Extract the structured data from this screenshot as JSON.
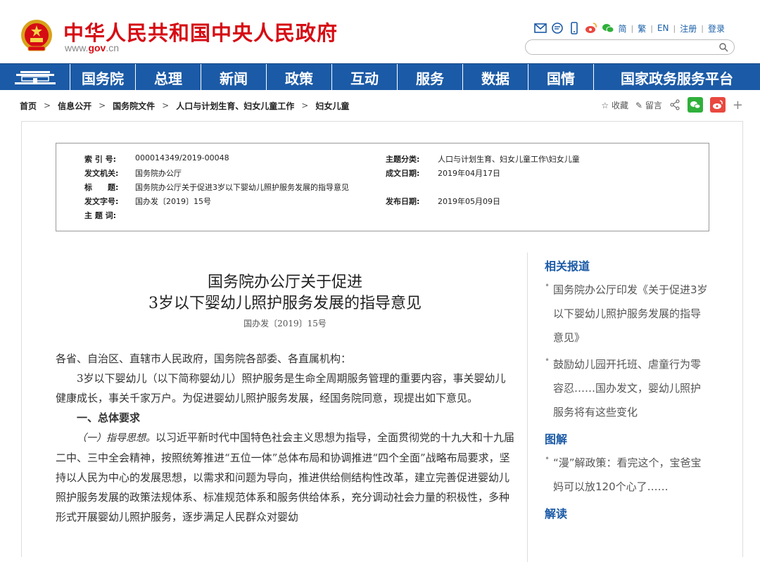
{
  "header": {
    "title": "中华人民共和国中央人民政府",
    "url_prefix": "www.",
    "url_domain": "gov",
    "url_suffix": ".cn",
    "lang_links": [
      "简",
      "繁",
      "EN",
      "注册",
      "登录"
    ],
    "search_placeholder": ""
  },
  "nav": {
    "items": [
      "国务院",
      "总理",
      "新闻",
      "政策",
      "互动",
      "服务",
      "数据",
      "国情",
      "国家政务服务平台"
    ]
  },
  "breadcrumb": {
    "items": [
      "首页",
      "信息公开",
      "国务院文件",
      "人口与计划生育、妇女儿童工作",
      "妇女儿童"
    ],
    "separator": ">"
  },
  "tools": {
    "favorite": "收藏",
    "comment": "留言"
  },
  "meta": {
    "index_label": "索 引 号:",
    "index_value": "000014349/2019-00048",
    "topic_label": "主题分类:",
    "topic_value": "人口与计划生育、妇女儿童工作\\妇女儿童",
    "issuer_label": "发文机关:",
    "issuer_value": "国务院办公厅",
    "created_label": "成文日期:",
    "created_value": "2019年04月17日",
    "title_label": "标　　题:",
    "title_value": "国务院办公厅关于促进3岁以下婴幼儿照护服务发展的指导意见",
    "docno_label": "发文字号:",
    "docno_value": "国办发〔2019〕15号",
    "published_label": "发布日期:",
    "published_value": "2019年05月09日",
    "keywords_label": "主 题 词:",
    "keywords_value": ""
  },
  "article": {
    "title_line1": "国务院办公厅关于促进",
    "title_line2": "3岁以下婴幼儿照护服务发展的指导意见",
    "docno": "国办发〔2019〕15号",
    "salutation": "各省、自治区、直辖市人民政府，国务院各部委、各直属机构：",
    "para1": "3岁以下婴幼儿（以下简称婴幼儿）照护服务是生命全周期服务管理的重要内容，事关婴幼儿健康成长，事关千家万户。为促进婴幼儿照护服务发展，经国务院同意，现提出如下意见。",
    "heading1": "一、总体要求",
    "para2_lead": "（一）指导思想。",
    "para2": "以习近平新时代中国特色社会主义思想为指导，全面贯彻党的十九大和十九届二中、三中全会精神，按照统筹推进“五位一体”总体布局和协调推进“四个全面”战略布局要求，坚持以人民为中心的发展思想，以需求和问题为导向，推进供给侧结构性改革，建立完善促进婴幼儿照护服务发展的政策法规体系、标准规范体系和服务供给体系，充分调动社会力量的积极性，多种形式开展婴幼儿照护服务，逐步满足人民群众对婴幼"
  },
  "sidebar": {
    "related_title": "相关报道",
    "related": [
      "国务院办公厅印发《关于促进3岁以下婴幼儿照护服务发展的指导意见》",
      "鼓励幼儿园开托班、虐童行为零容忍……国办发文，婴幼儿照护服务将有这些变化"
    ],
    "graphic_title": "图解",
    "graphic": [
      "“漫”解政策：看完这个，宝爸宝妈可以放120个心了……"
    ],
    "reading_title": "解读"
  },
  "colors": {
    "brand_red": "#d60c14",
    "nav_blue": "#1b5aa6"
  }
}
